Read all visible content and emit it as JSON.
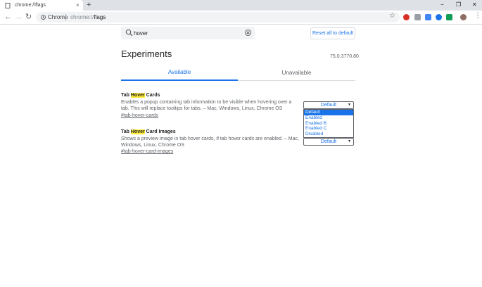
{
  "tab": {
    "title": "chrome://flags",
    "close": "×"
  },
  "new_tab": "+",
  "window_controls": {
    "minimize": "−",
    "maximize": "❐",
    "close": "✕"
  },
  "nav": {
    "back": "←",
    "forward": "→",
    "reload": "↻"
  },
  "omnibox": {
    "chip": "Chrome",
    "url_scheme": "chrome://",
    "url_host": "flags"
  },
  "toolbar_icons": [
    "star-icon",
    "adblock-icon",
    "extension-icon",
    "translate-icon",
    "download-icon",
    "sheets-icon",
    "avatar",
    "menu-icon"
  ],
  "accent": "#1a73e8",
  "search": {
    "value": "hover"
  },
  "reset_label": "Reset all to default",
  "heading": "Experiments",
  "version": "75.0.3770.80",
  "tabs": {
    "available": "Available",
    "unavailable": "Unavailable"
  },
  "experiments": [
    {
      "title_before": "Tab ",
      "title_highlight": "Hover",
      "title_after": " Cards",
      "description": "Enables a popup containing tab information to be visible when hovering over a tab. This will replace tooltips for tabs. – Mac, Windows, Linux, Chrome OS",
      "link": "#tab-hover-cards",
      "selected": "Default"
    },
    {
      "title_before": "Tab ",
      "title_highlight": "Hover",
      "title_after": " Card Images",
      "description": "Shows a preview image in tab hover cards, if tab hover cards are enabled. – Mac, Windows, Linux, Chrome OS",
      "link": "#tab-hover-card-images",
      "selected": "Default"
    }
  ],
  "dropdown_options": [
    "Default",
    "Enabled",
    "Enabled B",
    "Enabled C",
    "Disabled"
  ]
}
